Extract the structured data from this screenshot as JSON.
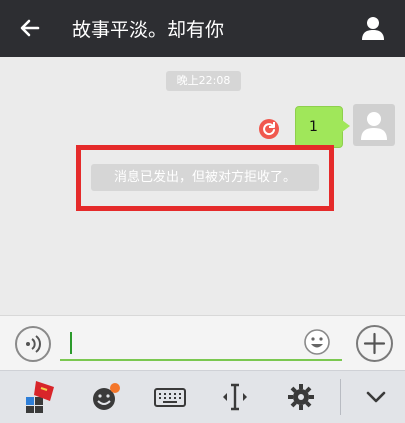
{
  "header": {
    "back_icon": "arrow-left-icon",
    "title": "故事平淡。却有你",
    "profile_icon": "person-icon"
  },
  "chat": {
    "timestamp": "晚上22:08",
    "outgoing_message": {
      "text": "1",
      "status_icon": "resend-icon",
      "status_color": "#f0584e",
      "bubble_color": "#a0e75a"
    },
    "system_message": "消息已发出，但被对方拒收了。",
    "highlight_color": "#e52a2a"
  },
  "input_bar": {
    "voice_icon": "voice-icon",
    "text_value": "",
    "emoji_icon": "emoji-icon",
    "plus_icon": "plus-icon",
    "accent": "#7bc850"
  },
  "keyboard_toolbar": {
    "items": [
      "app-grid-icon",
      "sticker-icon",
      "keyboard-icon",
      "text-cursor-icon",
      "settings-icon",
      "chevron-down-icon"
    ]
  }
}
